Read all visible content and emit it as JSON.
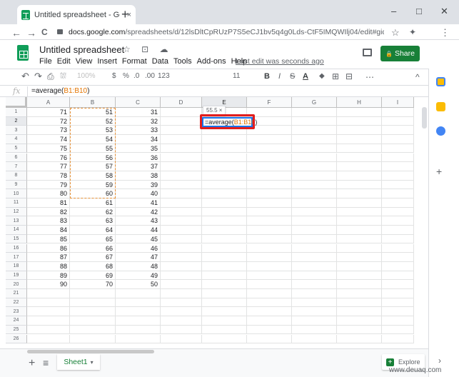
{
  "browser": {
    "tab_title": "Untitled spreadsheet - Google S",
    "tab_close": "×",
    "new_tab": "+",
    "url_host": "docs.google.com",
    "url_path": "/spreadsheets/d/12lsDltCpRUzP7S5eCJ1bv5q4g0Lds-CtF5IMQWIlj04/edit#gid=0",
    "nav_back": "←",
    "nav_forward": "→",
    "nav_reload": "C",
    "star_icon": "☆",
    "ext_icon": "✦",
    "menu_icon": "⋮",
    "win_min": "–",
    "win_max": "□",
    "win_close": "✕"
  },
  "header": {
    "title": "Untitled spreadsheet",
    "title_icons": "☆ ⊡ ☁",
    "menus": [
      "File",
      "Edit",
      "View",
      "Insert",
      "Format",
      "Data",
      "Tools",
      "Add-ons",
      "Help"
    ],
    "last_edit": "Last edit was seconds ago",
    "share_label": "Share",
    "share_icon": "🔒"
  },
  "toolbar": {
    "undo": "↶",
    "redo": "↷",
    "print": "⎙",
    "paint": "⛆",
    "zoom": "100%",
    "currency": "$",
    "percent": "%",
    "dec_less": ".0",
    "dec_more": ".00",
    "format_more": "123",
    "font_size": "11",
    "bold": "B",
    "italic": "I",
    "strike": "S",
    "text_color": "A",
    "fill": "◆",
    "borders": "⊞",
    "merge": "⊟",
    "more": "⋯",
    "collapse": "^"
  },
  "formula_bar": {
    "fx": "fx",
    "prefix": "=average(",
    "ref": "B1:B10",
    "suffix": ")"
  },
  "grid": {
    "columns": [
      "A",
      "B",
      "C",
      "D",
      "E",
      "F",
      "G",
      "H",
      "I"
    ],
    "rows": [
      "1",
      "2",
      "3",
      "4",
      "5",
      "6",
      "7",
      "8",
      "9",
      "10",
      "11",
      "12",
      "13",
      "14",
      "15",
      "16",
      "17",
      "18",
      "19",
      "20",
      "21",
      "22",
      "23",
      "24",
      "25",
      "26"
    ],
    "col_a": [
      "71",
      "72",
      "73",
      "74",
      "75",
      "76",
      "77",
      "78",
      "79",
      "80",
      "81",
      "82",
      "83",
      "84",
      "85",
      "86",
      "87",
      "88",
      "89",
      "90"
    ],
    "col_b": [
      "51",
      "52",
      "53",
      "54",
      "55",
      "56",
      "57",
      "58",
      "59",
      "60",
      "61",
      "62",
      "63",
      "64",
      "65",
      "66",
      "67",
      "68",
      "69",
      "70"
    ],
    "col_c": [
      "31",
      "32",
      "33",
      "34",
      "35",
      "36",
      "37",
      "38",
      "39",
      "40",
      "41",
      "42",
      "43",
      "44",
      "45",
      "46",
      "47",
      "48",
      "49",
      "50"
    ],
    "active_cell_prefix": "=average(",
    "active_cell_ref": "B1:B10",
    "active_cell_suffix": ")",
    "tooltip": "55.5 ×",
    "range_color": "#e69138",
    "highlight_color": "#e11d1d",
    "active_color": "#1a73e8"
  },
  "bottom": {
    "add_sheet": "+",
    "all_sheets": "≡",
    "sheet_name": "Sheet1",
    "sheet_caret": "▾",
    "explore": "Explore",
    "explore_icon": "+",
    "watermark": "www.deuaq.com"
  },
  "side": {
    "plus": "+",
    "arrow": "›"
  }
}
